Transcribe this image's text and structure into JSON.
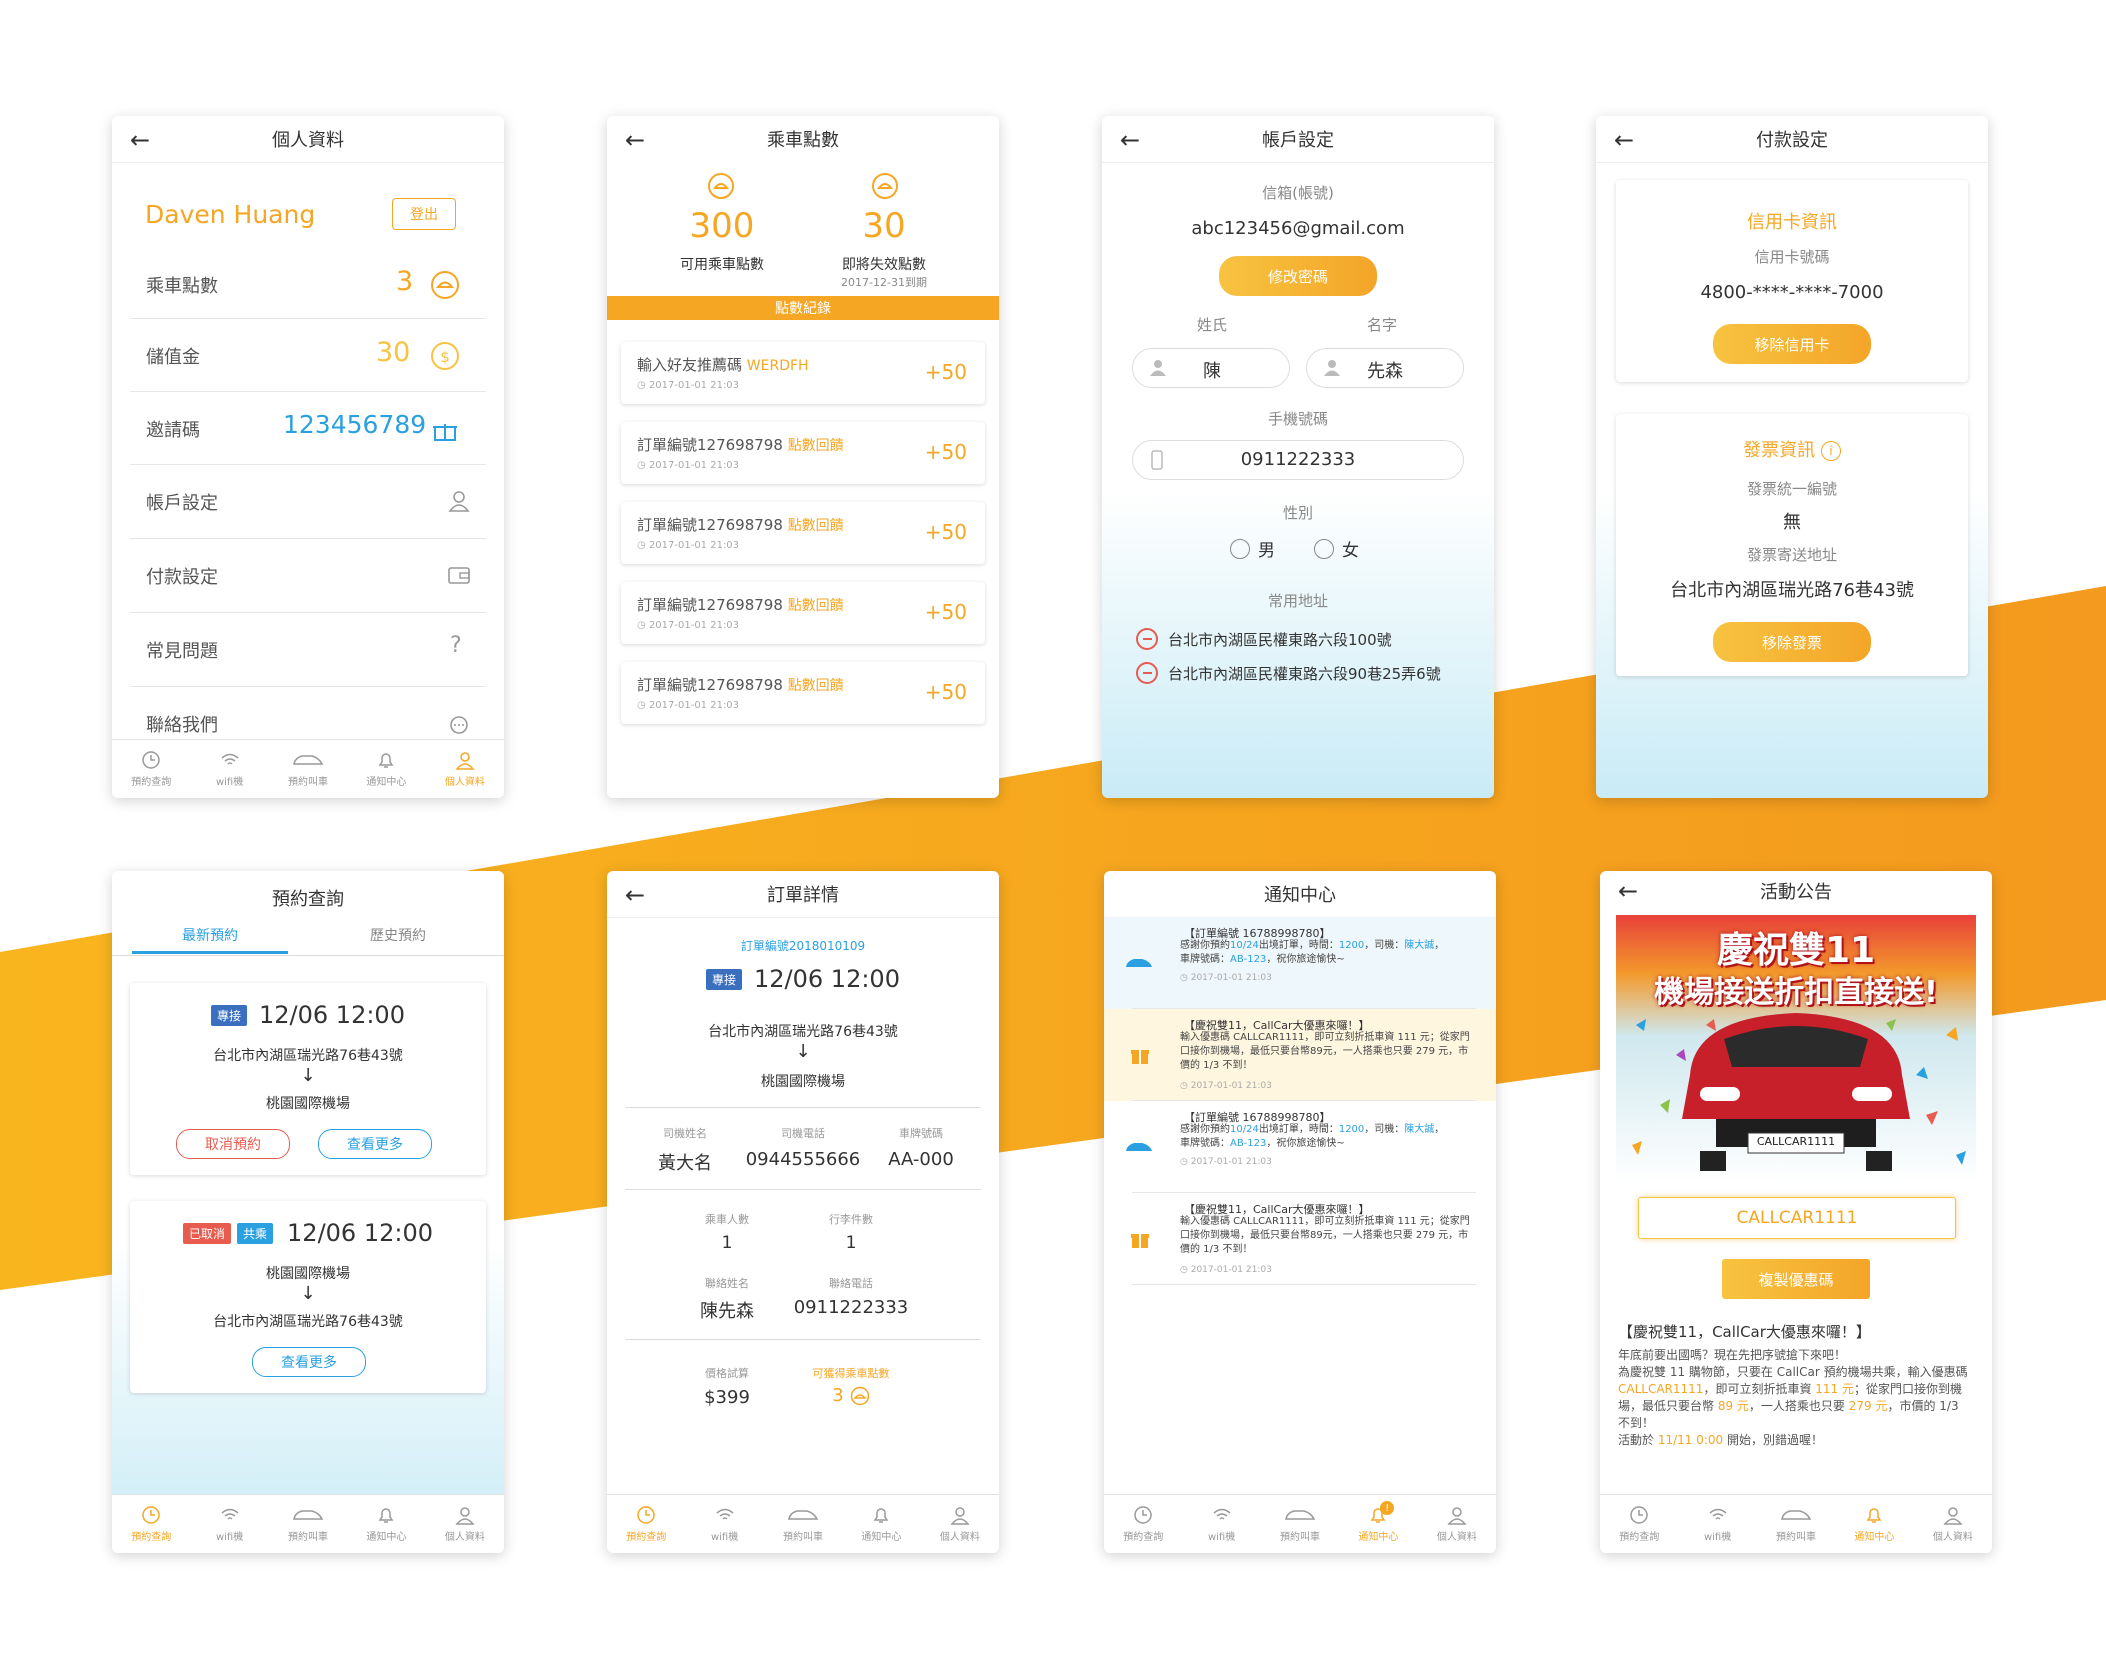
{
  "colors": {
    "accent": "#f5a623",
    "blue": "#2aa0e0",
    "red": "#e85b4f"
  },
  "nav": {
    "items": [
      "預約查詢",
      "wifi機",
      "預約叫車",
      "通知中心",
      "個人資料"
    ]
  },
  "profile": {
    "title": "個人資料",
    "name": "Daven Huang",
    "logout": "登出",
    "points_label": "乘車點數",
    "points_value": "3",
    "credit_label": "儲值金",
    "credit_value": "30",
    "invite_label": "邀請碼",
    "invite_value": "123456789",
    "menu": [
      "帳戶設定",
      "付款設定",
      "常見問題",
      "聯絡我們"
    ]
  },
  "points": {
    "title": "乘車點數",
    "available_value": "300",
    "available_label": "可用乘車點數",
    "expiring_value": "30",
    "expiring_label": "即將失效點數",
    "expiring_date": "2017-12-31到期",
    "record_header": "點數紀錄",
    "records": [
      {
        "text": "輸入好友推薦碼",
        "highlight": "WERDFH",
        "date": "2017-01-01 21:03",
        "delta": "+50"
      },
      {
        "text": "訂單編號127698798",
        "highlight": "點數回饋",
        "date": "2017-01-01 21:03",
        "delta": "+50"
      },
      {
        "text": "訂單編號127698798",
        "highlight": "點數回饋",
        "date": "2017-01-01 21:03",
        "delta": "+50"
      },
      {
        "text": "訂單編號127698798",
        "highlight": "點數回饋",
        "date": "2017-01-01 21:03",
        "delta": "+50"
      },
      {
        "text": "訂單編號127698798",
        "highlight": "點數回饋",
        "date": "2017-01-01 21:03",
        "delta": "+50"
      }
    ]
  },
  "account": {
    "title": "帳戶設定",
    "email_label": "信箱(帳號)",
    "email": "abc123456@gmail.com",
    "change_pw": "修改密碼",
    "surname_label": "姓氏",
    "given_label": "名字",
    "surname": "陳",
    "given": "先森",
    "phone_label": "手機號碼",
    "phone": "0911222333",
    "gender_label": "性別",
    "male": "男",
    "female": "女",
    "address_label": "常用地址",
    "addresses": [
      "台北市內湖區民權東路六段100號",
      "台北市內湖區民權東路六段90巷25弄6號"
    ]
  },
  "payment": {
    "title": "付款設定",
    "card_title": "信用卡資訊",
    "card_label": "信用卡號碼",
    "card_number": "4800-****-****-7000",
    "remove_card": "移除信用卡",
    "invoice_title": "發票資訊",
    "invoice_id_label": "發票統一編號",
    "invoice_id": "無",
    "invoice_addr_label": "發票寄送地址",
    "invoice_addr": "台北市內湖區瑞光路76巷43號",
    "remove_invoice": "移除發票"
  },
  "booking": {
    "title": "預約查詢",
    "tab_latest": "最新預約",
    "tab_history": "歷史預約",
    "card1": {
      "badge": "專接",
      "time": "12/06 12:00",
      "from": "台北市內湖區瑞光路76巷43號",
      "arrow": "↓",
      "to": "桃園國際機場",
      "cancel": "取消預約",
      "more": "查看更多"
    },
    "card2": {
      "badge_cancel": "已取消",
      "badge_share": "共乘",
      "time": "12/06 12:00",
      "from": "桃園國際機場",
      "arrow": "↓",
      "to": "台北市內湖區瑞光路76巷43號",
      "more": "查看更多"
    }
  },
  "order": {
    "title": "訂單詳情",
    "order_no": "訂單編號2018010109",
    "badge": "專接",
    "time": "12/06 12:00",
    "from": "台北市內湖區瑞光路76巷43號",
    "arrow": "↓",
    "to": "桃園國際機場",
    "driver_name_label": "司機姓名",
    "driver_phone_label": "司機電話",
    "plate_label": "車牌號碼",
    "driver_name": "黃大名",
    "driver_phone": "0944555666",
    "plate": "AA-000",
    "passengers_label": "乘車人數",
    "luggage_label": "行李件數",
    "passengers": "1",
    "luggage": "1",
    "contact_name_label": "聯絡姓名",
    "contact_phone_label": "聯絡電話",
    "contact_name": "陳先森",
    "contact_phone": "0911222333",
    "price_label": "價格試算",
    "points_label": "可獲得乘車點數",
    "price": "$399",
    "points": "3"
  },
  "notify": {
    "title": "通知中心",
    "items": [
      {
        "title": "【訂單編號 16788998780】",
        "l1a": "感謝你預約",
        "l1b": "10/24",
        "l1c": "出境訂單，時間：",
        "l1d": "1200",
        "l1e": "，司機：",
        "l1f": "陳大誠",
        "l1g": "，",
        "l2a": "車牌號碼：",
        "l2b": "AB-123",
        "l2c": "，祝你旅途愉快~",
        "date": "2017-01-01 21:03"
      },
      {
        "title": "【慶祝雙11，CallCar大優惠來囉！】",
        "body": "輸入優惠碼 CALLCAR1111，即可立刻折抵車資 111 元；從家門口接你到機場，最低只要台幣89元，一人搭乘也只要 279 元，市價的 1/3 不到！",
        "date": "2017-01-01 21:03"
      },
      {
        "title": "【訂單編號 16788998780】",
        "l1a": "感謝你預約",
        "l1b": "10/24",
        "l1c": "出境訂單，時間：",
        "l1d": "1200",
        "l1e": "，司機：",
        "l1f": "陳大誠",
        "l1g": "，",
        "l2a": "車牌號碼：",
        "l2b": "AB-123",
        "l2c": "，祝你旅途愉快~",
        "date": "2017-01-01 21:03"
      },
      {
        "title": "【慶祝雙11，CallCar大優惠來囉！】",
        "body": "輸入優惠碼 CALLCAR1111，即可立刻折抵車資 111 元；從家門口接你到機場，最低只要台幣89元，一人搭乘也只要 279 元，市價的 1/3 不到！",
        "date": "2017-01-01 21:03"
      }
    ]
  },
  "promo": {
    "title": "活動公告",
    "banner_line1": "慶祝雙11",
    "banner_line2": "機場接送折扣直接送!",
    "plate": "CALLCAR1111",
    "code": "CALLCAR1111",
    "copy": "複製優惠碼",
    "headline": "【慶祝雙11，CallCar大優惠來囉！】",
    "b1": "年底前要出國嗎？現在先把序號搶下來吧！",
    "b2a": "為慶祝雙 11 購物節，只要在 CallCar 預約機場共乘，輸入優惠碼 ",
    "b2b": "CALLCAR1111",
    "b2c": "，即可立刻折抵車資 ",
    "b2d": "111 元",
    "b2e": "；從家門口接你到機場，最低只要台幣 ",
    "b2f": "89 元",
    "b2g": "，一人搭乘也只要 ",
    "b2h": "279 元",
    "b2i": "，市價的 1/3 不到！",
    "b3a": "活動於 ",
    "b3b": "11/11 0:00",
    "b3c": " 開始，別錯過喔！"
  }
}
